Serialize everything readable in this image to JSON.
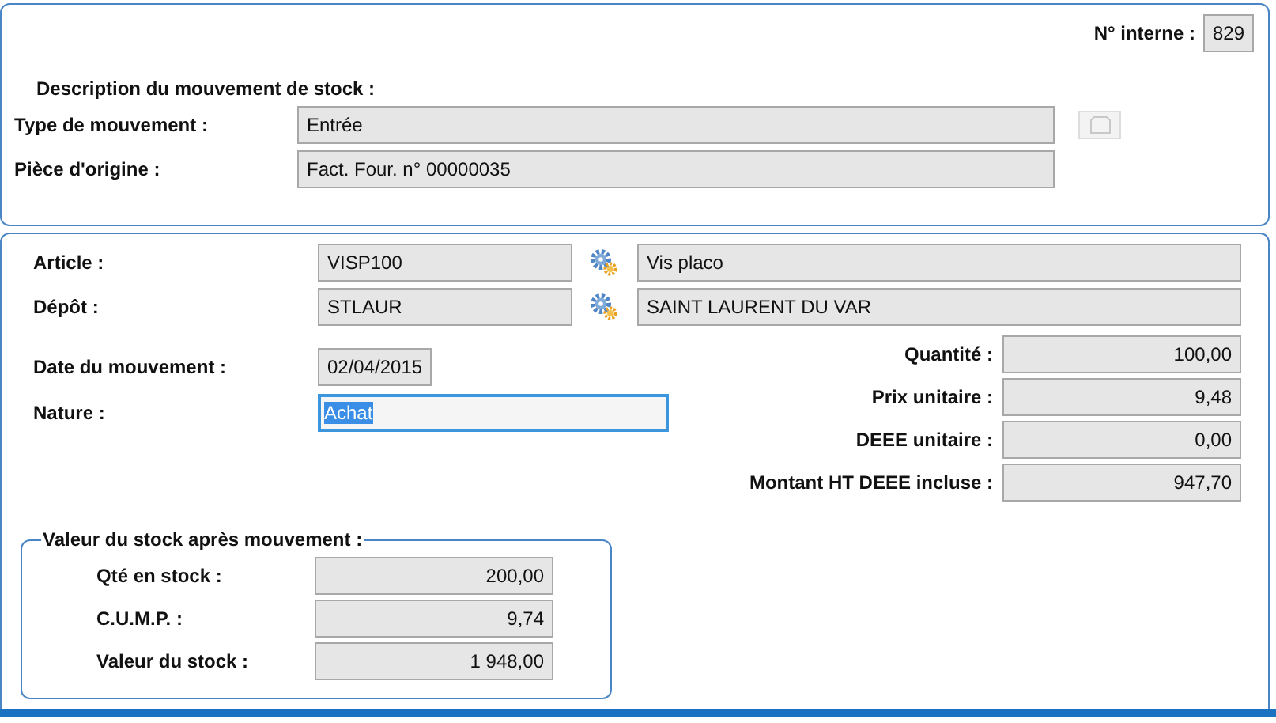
{
  "internal_number": {
    "label": "N° interne :",
    "value": "829"
  },
  "description": {
    "title": "Description du mouvement de stock :",
    "fields": [
      {
        "label": "Type de mouvement :",
        "value": "Entrée"
      },
      {
        "label": "Pièce d'origine :",
        "value": "Fact. Four. n° 00000035"
      }
    ],
    "button_disabled": true
  },
  "lookups": [
    {
      "label": "Article :",
      "code": "VISP100",
      "name": "Vis placo"
    },
    {
      "label": "Dépôt :",
      "code": "STLAUR",
      "name": "SAINT LAURENT DU VAR"
    }
  ],
  "date": {
    "label": "Date du mouvement :",
    "value": "02/04/2015"
  },
  "nature": {
    "label": "Nature :",
    "value": "Achat",
    "focused": true
  },
  "amounts": [
    {
      "label": "Quantité :",
      "value": "100,00"
    },
    {
      "label": "Prix unitaire :",
      "value": "9,48"
    },
    {
      "label": "DEEE unitaire :",
      "value": "0,00"
    },
    {
      "label": "Montant HT DEEE incluse :",
      "value": "947,70"
    }
  ],
  "stock_after": {
    "title": "Valeur du stock après mouvement :",
    "fields": [
      {
        "label": "Qté en stock :",
        "value": "200,00"
      },
      {
        "label": "C.U.M.P. :",
        "value": "9,74"
      },
      {
        "label": "Valeur du stock :",
        "value": "1 948,00"
      }
    ]
  }
}
